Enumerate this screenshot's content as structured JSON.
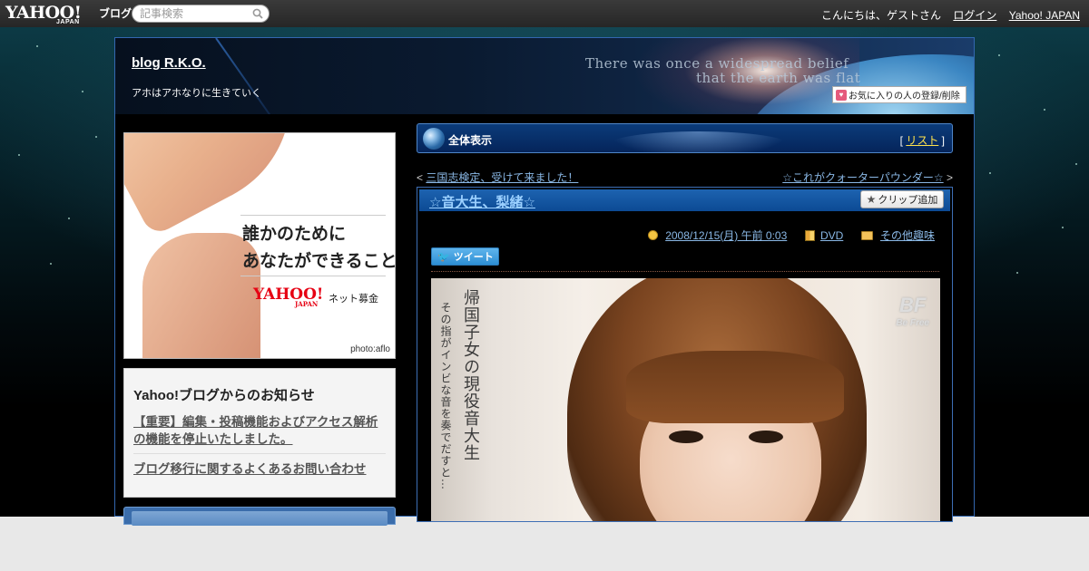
{
  "topbar": {
    "logo_text": "YAHOO!",
    "logo_sub": "JAPAN",
    "logo_blog": "ブログ",
    "search_placeholder": "記事検索",
    "greeting": "こんにちは、ゲストさん",
    "login": "ログイン",
    "yahoo_japan": "Yahoo! JAPAN"
  },
  "header": {
    "blog_title": "blog R.K.O.",
    "blog_subtitle": "アホはアホなりに生きていく",
    "tagline_1": "There was once a widespread belief",
    "tagline_2": "that the earth was flat",
    "favorite_button": "お気に入りの人の登録/削除"
  },
  "ad": {
    "line1": "誰かのために",
    "line2": "あなたができること",
    "brand": "YAHOO!",
    "brand_sub": "JAPAN",
    "service": "ネット募金",
    "credit": "photo:aflo"
  },
  "notice": {
    "title": "Yahoo!ブログからのお知らせ",
    "links": [
      "【重要】編集・投稿機能およびアクセス解析の機能を停止いたしました。",
      "ブログ移行に関するよくあるお問い合わせ"
    ]
  },
  "content": {
    "view_label": "全体表示",
    "list_link": "リスト",
    "prev_post": "三国志検定、受けて来ました！",
    "next_post": "☆これがクォーターパウンダー☆"
  },
  "article": {
    "title": "☆音大生、梨緒☆",
    "clip_button": "クリップ追加",
    "date": "2008/12/15(月) 午前 0:03",
    "category": "DVD",
    "genre": "その他趣味",
    "tweet_button": "ツイート",
    "cover_text_main": "帰国子女の現役音大生",
    "cover_text_sub": "その指がインビな音を奏でだすと…",
    "cover_logo": "BF",
    "cover_logo_sub": "Be Free"
  },
  "colors": {
    "accent_blue": "#1d63b0",
    "link_blue": "#8ab8e6",
    "list_yellow": "#ffe24d",
    "title_blue": "#9bd0ff"
  },
  "icons": [
    "search-icon",
    "heart-icon",
    "globe-icon",
    "star-icon",
    "clock-icon",
    "book-icon",
    "folder-icon",
    "twitter-bird-icon"
  ]
}
